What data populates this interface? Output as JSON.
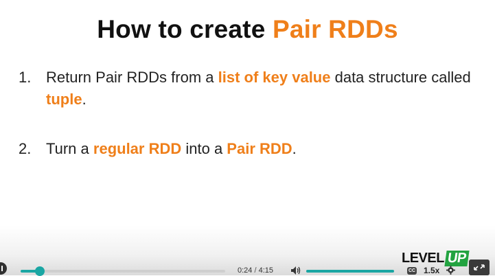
{
  "slide": {
    "title_prefix": "How to create ",
    "title_highlight": "Pair RDDs",
    "items": [
      {
        "number": "1.",
        "parts": [
          "Return Pair RDDs from a ",
          "list of key value",
          " data structure called ",
          "tuple",
          "."
        ]
      },
      {
        "number": "2.",
        "parts": [
          "Turn a ",
          "regular RDD",
          " into a ",
          "Pair RDD",
          "."
        ]
      }
    ],
    "accent_color": "#ef7f1a"
  },
  "player": {
    "current_time": "0:24",
    "time_separator": "/",
    "duration": "4:15",
    "progress_fraction": 0.094,
    "volume_fraction": 1.0,
    "speed": "1.5x",
    "cc_label": "CC",
    "accent_color": "#1aa6a3"
  },
  "logo": {
    "text_main": "LEVEL",
    "text_accent": "UP"
  }
}
